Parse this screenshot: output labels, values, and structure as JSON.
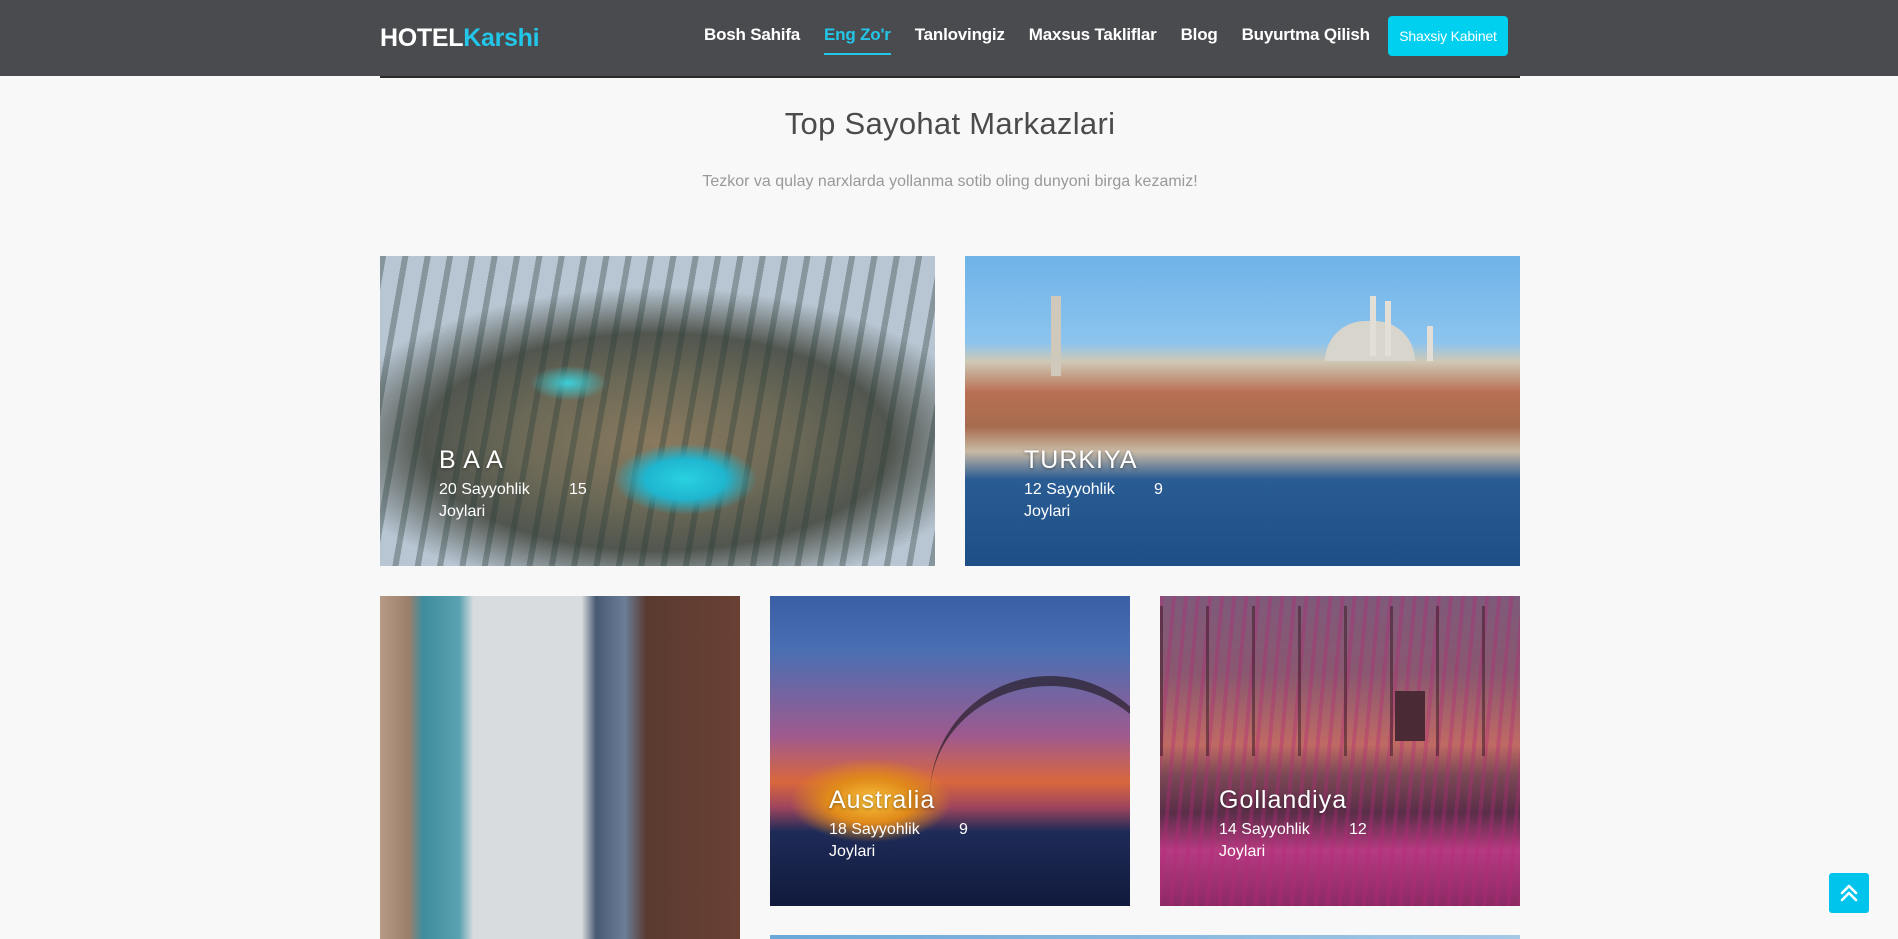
{
  "header": {
    "logo_part1": "HOTEL",
    "logo_part2": "Karshi",
    "nav": [
      {
        "label": "Bosh Sahifa",
        "active": false
      },
      {
        "label": "Eng Zo'r",
        "active": true
      },
      {
        "label": "Tanlovingiz",
        "active": false
      },
      {
        "label": "Maxsus Takliflar",
        "active": false
      },
      {
        "label": "Blog",
        "active": false
      },
      {
        "label": "Buyurtma Qilish",
        "active": false
      }
    ],
    "cabinet_button": "Shaxsiy Kabinet"
  },
  "section": {
    "title": "Top Sayohat Markazlari",
    "subtitle": "Tezkor va qulay narxlarda yollanma sotib oling dunyoni birga kezamiz!"
  },
  "destinations": [
    {
      "name": "B A A",
      "tours": "20 Sayyohlik Joylari",
      "count": "15"
    },
    {
      "name": "TURKIYA",
      "tours": "12 Sayyohlik Joylari",
      "count": "9"
    },
    {
      "name": "Australia",
      "tours": "18 Sayyohlik Joylari",
      "count": "9"
    },
    {
      "name": "Gollandiya",
      "tours": "14 Sayyohlik Joylari",
      "count": "12"
    }
  ],
  "icons": {
    "scroll_top": "double-chevron-up-icon"
  },
  "colors": {
    "accent": "#22c6e8",
    "header_bg": "#4a4b4f",
    "button_bg": "#00d0f0"
  }
}
